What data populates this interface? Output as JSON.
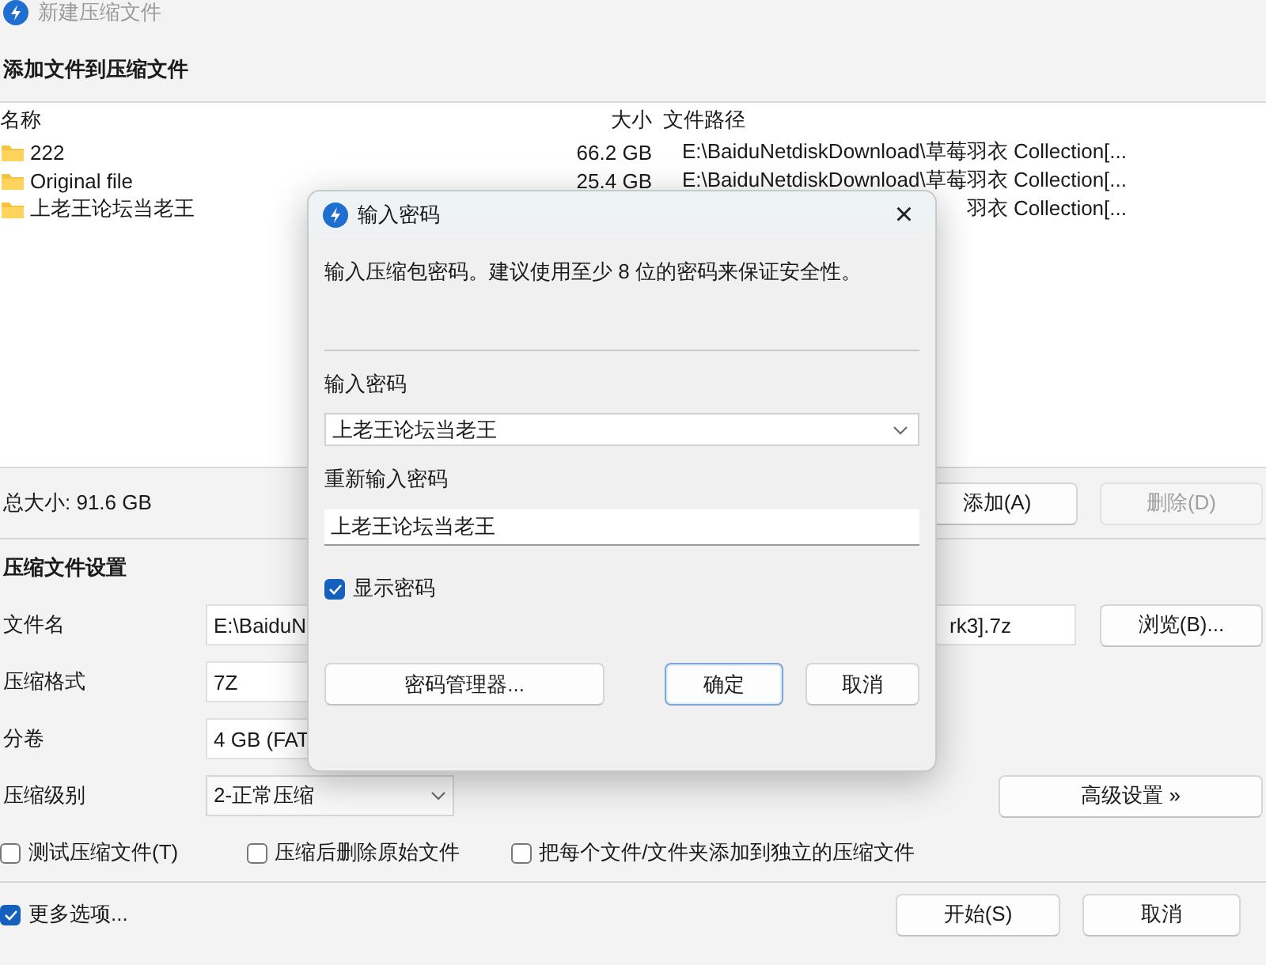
{
  "main_window": {
    "title": "新建压缩文件",
    "section_title": "添加文件到压缩文件",
    "file_list": {
      "columns": [
        "名称",
        "大小",
        "文件路径"
      ],
      "rows": [
        {
          "name": "222",
          "size": "66.2 GB",
          "path": "E:\\BaiduNetdiskDownload\\草莓羽衣 Collection[..."
        },
        {
          "name": "Original file",
          "size": "25.4 GB",
          "path": "E:\\BaiduNetdiskDownload\\草莓羽衣 Collection[..."
        },
        {
          "name": "上老王论坛当老王",
          "path": "羽衣 Collection[..."
        }
      ]
    },
    "total_size": "总大小: 91.6 GB",
    "list_buttons": [
      {
        "label": "添加(A)",
        "disabled": false
      },
      {
        "label": "删除(D)",
        "disabled": true
      }
    ],
    "settings_title": "压缩文件设置",
    "settings": [
      {
        "kind": "text",
        "label": "文件名",
        "value": "E:\\BaiduN",
        "value_tail": "rk3].7z",
        "button": "浏览(B)..."
      },
      {
        "kind": "text",
        "label": "压缩格式",
        "value": "7Z"
      },
      {
        "kind": "text",
        "label": "分卷",
        "value": "4 GB (FAT"
      },
      {
        "kind": "dropdown",
        "label": "压缩级别",
        "value": "2-正常压缩",
        "button": "高级设置 »"
      }
    ],
    "options": [
      {
        "label": "测试压缩文件(T)",
        "checked": false
      },
      {
        "label": "压缩后删除原始文件",
        "checked": false
      },
      {
        "label": "把每个文件/文件夹添加到独立的压缩文件",
        "checked": false
      }
    ],
    "more_options": {
      "label": "更多选项...",
      "checked": true
    },
    "buttons": [
      "开始(S)",
      "取消"
    ]
  },
  "dialog": {
    "title": "输入密码",
    "close": "×",
    "message": "输入压缩包密码。建议使用至少 8 位的密码来保证安全性。",
    "password_label": "输入密码",
    "password": "上老王论坛当老王",
    "confirm_label": "重新输入密码",
    "confirm": "上老王论坛当老王",
    "show_password": {
      "label": "显示密码",
      "checked": true
    },
    "buttons": [
      {
        "label": "密码管理器...",
        "default": false
      },
      {
        "label": "确定",
        "default": true
      },
      {
        "label": "取消",
        "default": false
      }
    ]
  }
}
